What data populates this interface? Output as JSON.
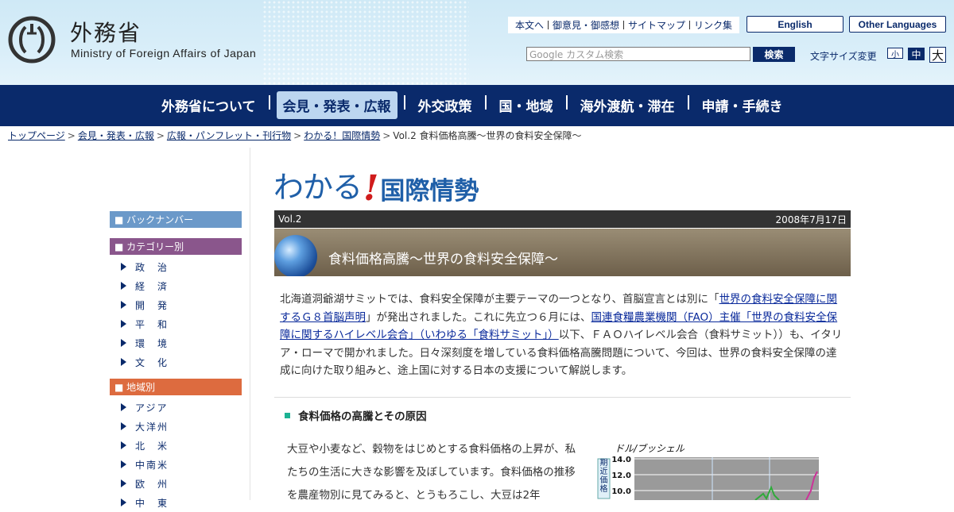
{
  "header": {
    "logo_jp": "外務省",
    "logo_en": "Ministry of Foreign Affairs of Japan",
    "util_links": [
      "本文へ",
      "御意見・御感想",
      "サイトマップ",
      "リンク集"
    ],
    "lang_english": "English",
    "lang_other": "Other Languages",
    "search_placeholder": "Google カスタム検索",
    "search_button": "検索",
    "fontsize_label": "文字サイズ変更",
    "fontsize_small": "小",
    "fontsize_medium": "中",
    "fontsize_large": "大"
  },
  "nav": {
    "items": [
      "外務省について",
      "会見・発表・広報",
      "外交政策",
      "国・地域",
      "海外渡航・滞在",
      "申請・手続き"
    ],
    "active_index": 1
  },
  "breadcrumb": [
    "トップページ",
    "会見・発表・広報",
    "広報・パンフレット・刊行物",
    "わかる！国際情勢",
    "Vol.2 食料価格高騰～世界の食料安全保障～"
  ],
  "sidebar": {
    "backnumber": "■ バックナンバー",
    "category_head": "■ カテゴリー別",
    "categories": [
      "政　治",
      "経　済",
      "開　発",
      "平　和",
      "環　境",
      "文　化"
    ],
    "region_head": "■ 地域別",
    "regions": [
      "アジア",
      "大洋州",
      "北　米",
      "中南米",
      "欧　州",
      "中　東"
    ]
  },
  "article": {
    "logo_kana": "わかる",
    "logo_bang": "!",
    "logo_kanji": "国際情勢",
    "vol": "Vol.2",
    "date": "2008年7月17日",
    "title": "食料価格高騰～世界の食料安全保障～",
    "intro_1": "北海道洞爺湖サミットでは、食料安全保障が主要テーマの一つとなり、首脳宣言とは別に「",
    "intro_link_1": "世界の食料安全保障に関するＧ８首脳声明",
    "intro_2": "」が発出されました。これに先立つ６月には、",
    "intro_link_2": "国連食糧農業機関（FAO）主催「世界の食料安全保障に関するハイレベル会合」（いわゆる「食料サミット」）",
    "intro_3": "以下、ＦＡＯハイレベル会合（食料サミット））も、イタリア・ローマで開かれました。日々深刻度を増している食料価格高騰問題について、今回は、世界の食料安全保障の達成に向けた取り組みと、途上国に対する日本の支援について解説します。",
    "section_title": "食料価格の高騰とその原因",
    "body": "大豆や小麦など、穀物をはじめとする食料価格の上昇が、私たちの生活に大きな影響を及ぼしています。食料価格の推移を農産物別に見てみると、とうもろこし、大豆は2年"
  },
  "chart_data": {
    "type": "line",
    "ylabel": "ドル/ブッシェル",
    "side_label": "期近価格",
    "y_ticks": [
      "14.0",
      "12.0",
      "10.0"
    ],
    "series_colors": [
      "#2faa3a",
      "#cc3399"
    ]
  },
  "colors": {
    "navy": "#0a2a6b",
    "backnumber": "#6b99c9",
    "category": "#8a568c",
    "region": "#dd6b3f"
  }
}
